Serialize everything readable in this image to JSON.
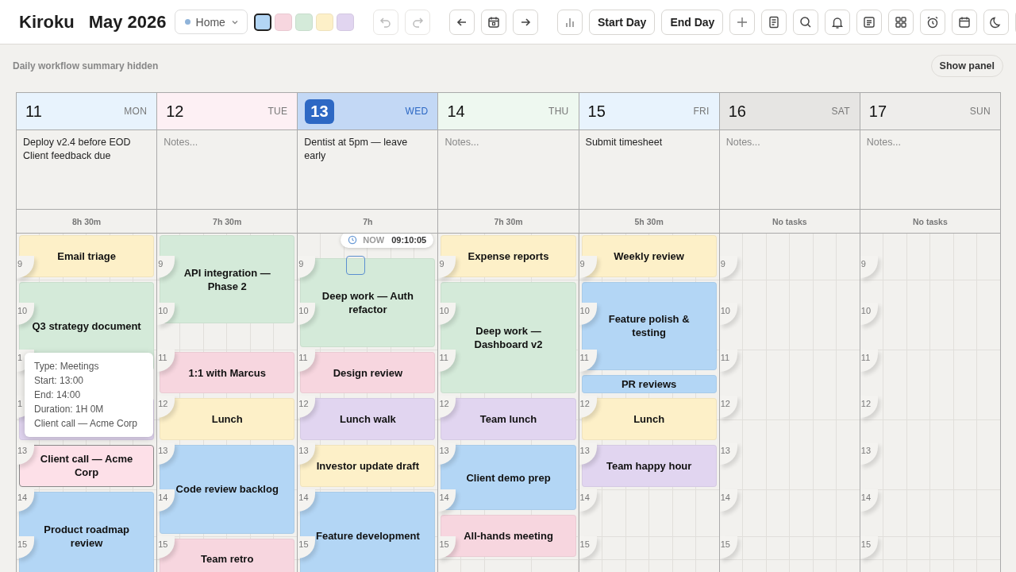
{
  "app": {
    "name": "Kiroku",
    "period": "May 2026"
  },
  "workspace": {
    "label": "Home",
    "color": "#8fb3d9"
  },
  "swatches": [
    {
      "color": "#b3d6f5",
      "selected": true
    },
    {
      "color": "#f7d6df",
      "selected": false
    },
    {
      "color": "#d4ead9",
      "selected": false
    },
    {
      "color": "#fdf0c8",
      "selected": false
    },
    {
      "color": "#e1d5f0",
      "selected": false
    }
  ],
  "history": [
    {
      "kind": "undo",
      "disabled": true
    },
    {
      "kind": "redo",
      "disabled": true
    }
  ],
  "actions": [
    "Start Day",
    "End Day"
  ],
  "summary": {
    "text": "Daily workflow summary hidden",
    "button": "Show panel"
  },
  "now_indicator": {
    "label": "NOW",
    "time": "09:10:05"
  },
  "days": [
    {
      "date": "11",
      "weekday": "MON",
      "color": "#e8f3fd",
      "today": false,
      "notes": [
        "Deploy v2.4 before EOD",
        "Client feedback due"
      ],
      "total": "8h 30m",
      "hours": [
        "9",
        "10",
        "1",
        "1",
        "13",
        "14",
        "15"
      ],
      "events": [
        {
          "title": "Email triage",
          "color": "#fdf0c8",
          "hovered": false
        },
        {
          "title": "Q3 strategy document",
          "color": "#d4ead9",
          "hovered": false
        },
        {
          "color": "#e1d5f0",
          "hovered": false
        },
        {
          "title": "Client call — Acme Corp",
          "color": "#fde0e8",
          "hovered": true
        },
        {
          "title": "Product roadmap review",
          "color": "#b3d6f5",
          "hovered": false
        }
      ],
      "tooltip": [
        "Type: Meetings",
        "Start: 13:00",
        "End: 14:00",
        "Duration: 1H 0M",
        "Client call — Acme Corp"
      ]
    },
    {
      "date": "12",
      "weekday": "TUE",
      "color": "#fdf0f4",
      "today": false,
      "placeholder": "Notes...",
      "total": "7h 30m",
      "hours": [
        "9",
        "10",
        "11",
        "12",
        "13",
        "14",
        "15"
      ],
      "events": [
        {
          "title": "API integration — Phase 2",
          "color": "#d4ead9",
          "hovered": false
        },
        {
          "title": "1:1 with Marcus",
          "color": "#f7d6df",
          "hovered": false
        },
        {
          "title": "Lunch",
          "color": "#fdf0c8",
          "hovered": false
        },
        {
          "title": "Code review backlog",
          "color": "#b3d6f5",
          "hovered": false
        },
        {
          "title": "Team retro",
          "color": "#f7d6df",
          "hovered": false
        }
      ]
    },
    {
      "date": "13",
      "weekday": "WED",
      "color": "#c3d8f5",
      "today": true,
      "notes": [
        "Dentist at 5pm — leave early"
      ],
      "total": "7h",
      "hours": [
        "9",
        "10",
        "11",
        "12",
        "13",
        "14",
        "15"
      ],
      "events": [
        {
          "title": "Deep work — Auth refactor",
          "color": "#d4ead9",
          "hovered": false
        },
        {
          "title": "Design review",
          "color": "#f7d6df",
          "hovered": false
        },
        {
          "title": "Lunch walk",
          "color": "#e1d5f0",
          "hovered": false
        },
        {
          "title": "Investor update draft",
          "color": "#fdf0c8",
          "hovered": false
        },
        {
          "title": "Feature development",
          "color": "#b3d6f5",
          "hovered": false
        }
      ]
    },
    {
      "date": "14",
      "weekday": "THU",
      "color": "#eef8f0",
      "today": false,
      "placeholder": "Notes...",
      "total": "7h 30m",
      "hours": [
        "9",
        "10",
        "11",
        "12",
        "13",
        "14",
        "15"
      ],
      "events": [
        {
          "title": "Expense reports",
          "color": "#fdf0c8",
          "hovered": false
        },
        {
          "title": "Deep work — Dashboard v2",
          "color": "#d4ead9",
          "hovered": false
        },
        {
          "title": "Team lunch",
          "color": "#e1d5f0",
          "hovered": false
        },
        {
          "title": "Client demo prep",
          "color": "#b3d6f5",
          "hovered": false
        },
        {
          "title": "All-hands meeting",
          "color": "#f7d6df",
          "hovered": false
        }
      ]
    },
    {
      "date": "15",
      "weekday": "FRI",
      "color": "#e8f3fd",
      "today": false,
      "notes": [
        "Submit timesheet"
      ],
      "total": "5h 30m",
      "hours": [
        "9",
        "10",
        "11",
        "12",
        "13",
        "14",
        "15"
      ],
      "events": [
        {
          "title": "Weekly review",
          "color": "#fdf0c8",
          "hovered": false
        },
        {
          "title": "Feature polish & testing",
          "color": "#b3d6f5",
          "hovered": false
        },
        {
          "title": "PR reviews",
          "color": "#b3d6f5",
          "hovered": false
        },
        {
          "title": "Lunch",
          "color": "#fdf0c8",
          "hovered": false
        },
        {
          "title": "Team happy hour",
          "color": "#e1d5f0",
          "hovered": false
        }
      ]
    },
    {
      "date": "16",
      "weekday": "SAT",
      "color": "#e6e5e3",
      "today": false,
      "placeholder": "Notes...",
      "total": "No tasks",
      "hours": [
        "9",
        "10",
        "11",
        "12",
        "13",
        "14",
        "15"
      ]
    },
    {
      "date": "17",
      "weekday": "SUN",
      "color": "#eeedeb",
      "today": false,
      "placeholder": "Notes...",
      "total": "No tasks",
      "hours": [
        "9",
        "10",
        "11",
        "12",
        "13",
        "14",
        "15"
      ]
    }
  ]
}
